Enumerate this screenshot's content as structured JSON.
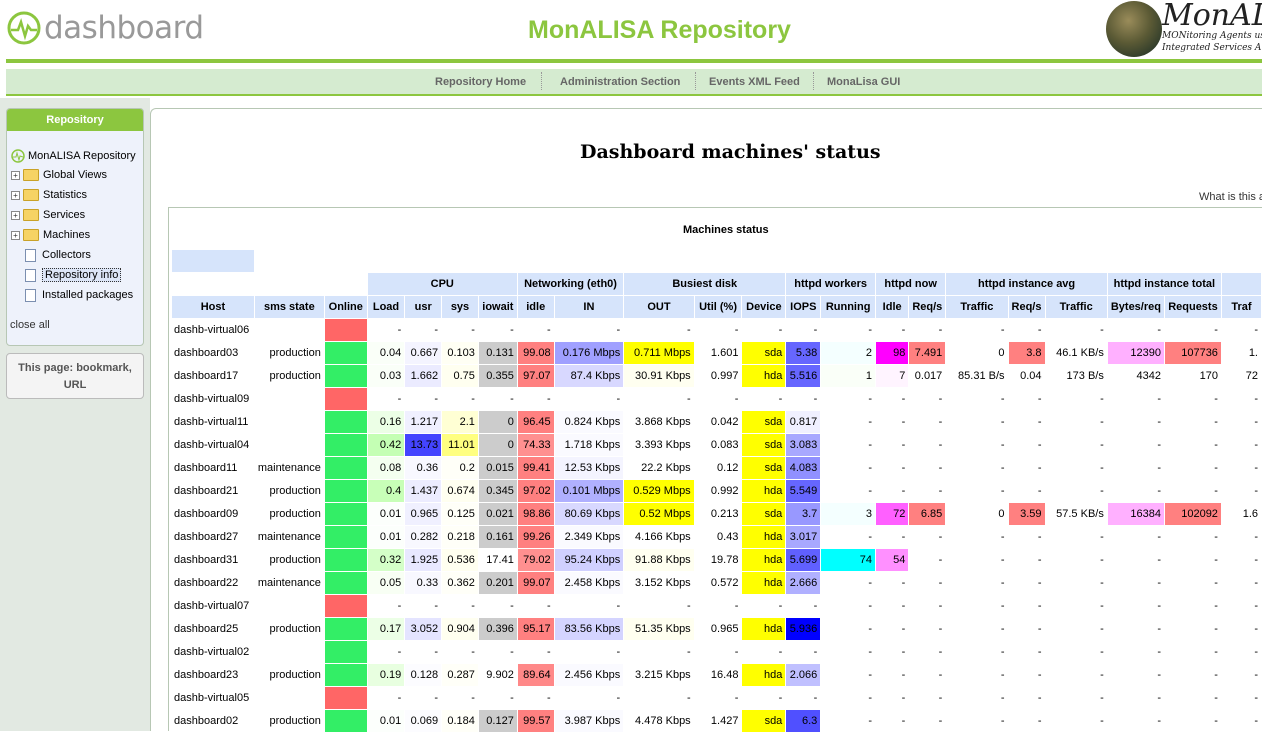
{
  "header": {
    "logo_text": "dashboard",
    "site_title": "MonALISA Repository",
    "monalisa_name": "MonALI",
    "monalisa_sub1": "MONitoring Agents usi",
    "monalisa_sub2": "Integrated Services Archi"
  },
  "nav": {
    "items": [
      "Repository Home",
      "Administration Section",
      "Events XML Feed",
      "MonaLisa GUI"
    ]
  },
  "sidebar": {
    "box_title": "Repository",
    "tree": [
      {
        "label": "MonALISA Repository",
        "type": "root"
      },
      {
        "label": "Global Views",
        "type": "folder"
      },
      {
        "label": "Statistics",
        "type": "folder"
      },
      {
        "label": "Services",
        "type": "folder"
      },
      {
        "label": "Machines",
        "type": "folder"
      },
      {
        "label": "Collectors",
        "type": "doc"
      },
      {
        "label": "Repository info",
        "type": "doc",
        "selected": true
      },
      {
        "label": "Installed packages",
        "type": "doc"
      }
    ],
    "close_all": "close all",
    "page_box_line1": "This page: bookmark,",
    "page_box_line2": "URL"
  },
  "main": {
    "page_title": "Dashboard machines' status",
    "what_is_this": "What is this a",
    "table_title": "Machines status"
  },
  "colors": {
    "accent_green": "#8cc63f",
    "online_green": "#33ee66",
    "offline_red": "#ff6666",
    "header_blue": "#d6e4fb"
  },
  "table": {
    "group_headers": [
      {
        "label": "",
        "span": 3
      },
      {
        "label": "CPU",
        "span": 4
      },
      {
        "label": "Networking (eth0)",
        "span": 2
      },
      {
        "label": "Busiest disk",
        "span": 3
      },
      {
        "label": "httpd workers",
        "span": 2
      },
      {
        "label": "httpd now",
        "span": 2
      },
      {
        "label": "httpd instance avg",
        "span": 3
      },
      {
        "label": "httpd instance total",
        "span": 2
      },
      {
        "label": "",
        "span": 1
      }
    ],
    "columns": [
      "Host",
      "sms state",
      "Online",
      "Load",
      "usr",
      "sys",
      "iowait",
      "idle",
      "IN",
      "OUT",
      "Util (%)",
      "Device",
      "IOPS",
      "Running",
      "Idle",
      "Req/s",
      "Traffic",
      "Req/s",
      "Traffic",
      "Bytes/req",
      "Requests",
      "Traf"
    ],
    "rows": [
      {
        "host": "dashb-virtual06",
        "sms": "",
        "online": false,
        "cells": [
          "-",
          "-",
          "-",
          "-",
          "-",
          "-",
          "-",
          "-",
          "-",
          "-",
          "-",
          "-",
          "-",
          "-",
          "-",
          "-",
          "-",
          "-",
          "-"
        ],
        "colors": [
          "",
          "",
          "",
          "",
          "",
          "",
          "",
          "",
          "",
          "",
          "",
          "",
          "",
          "",
          "",
          "",
          "",
          "",
          ""
        ]
      },
      {
        "host": "dashboard03",
        "sms": "production",
        "online": true,
        "cells": [
          "0.04",
          "0.667",
          "0.103",
          "0.131",
          "99.08",
          "0.176 Mbps",
          "0.711 Mbps",
          "1.601",
          "sda",
          "5.38",
          "2",
          "98",
          "7.491",
          "0",
          "3.8",
          "46.1 KB/s",
          "12390",
          "107736",
          "1."
        ],
        "colors": [
          "#fafff8",
          "#f4f4ff",
          "#fffff4",
          "#cccccc",
          "#ff8080",
          "#a0a0ff",
          "#ffff00",
          "",
          "#ffff00",
          "#6666ff",
          "#f4ffff",
          "#ff00ff",
          "#ff8080",
          "",
          "#ff8080",
          "",
          "#ffb0ff",
          "#ff8080",
          ""
        ]
      },
      {
        "host": "dashboard17",
        "sms": "production",
        "online": true,
        "cells": [
          "0.03",
          "1.662",
          "0.75",
          "0.355",
          "97.07",
          "87.4 Kbps",
          "30.91 Kbps",
          "0.997",
          "hda",
          "5.516",
          "1",
          "7",
          "0.017",
          "85.31 B/s",
          "0.04",
          "173 B/s",
          "4342",
          "170",
          "72"
        ],
        "colors": [
          "#fafff8",
          "#ebebff",
          "#fffff0",
          "#cccccc",
          "#ff8080",
          "#d8d8ff",
          "#fffff0",
          "",
          "#ffff00",
          "#6666ff",
          "#fafff8",
          "#fff4ff",
          "",
          "",
          "",
          "",
          "",
          "",
          ""
        ]
      },
      {
        "host": "dashb-virtual09",
        "sms": "",
        "online": false,
        "cells": [
          "-",
          "-",
          "-",
          "-",
          "-",
          "-",
          "-",
          "-",
          "-",
          "-",
          "-",
          "-",
          "-",
          "-",
          "-",
          "-",
          "-",
          "-",
          "-"
        ],
        "colors": [
          "",
          "",
          "",
          "",
          "",
          "",
          "",
          "",
          "",
          "",
          "",
          "",
          "",
          "",
          "",
          "",
          "",
          "",
          ""
        ]
      },
      {
        "host": "dashb-virtual11",
        "sms": "",
        "online": true,
        "cells": [
          "0.16",
          "1.217",
          "2.1",
          "0",
          "96.45",
          "0.824 Kbps",
          "3.868 Kbps",
          "0.042",
          "sda",
          "0.817",
          "-",
          "-",
          "-",
          "-",
          "-",
          "-",
          "-",
          "-",
          "-"
        ],
        "colors": [
          "#ecffe6",
          "#f0f0ff",
          "#ffffd4",
          "#cccccc",
          "#ff8080",
          "#fafaff",
          "",
          "",
          "#ffff00",
          "#f0f0ff",
          "",
          "",
          "",
          "",
          "",
          "",
          "",
          "",
          ""
        ]
      },
      {
        "host": "dashb-virtual04",
        "sms": "",
        "online": true,
        "cells": [
          "0.42",
          "13.73",
          "11.01",
          "0",
          "74.33",
          "1.718 Kbps",
          "3.393 Kbps",
          "0.083",
          "sda",
          "3.083",
          "-",
          "-",
          "-",
          "-",
          "-",
          "-",
          "-",
          "-",
          "-"
        ],
        "colors": [
          "#c4ffb4",
          "#4444ff",
          "#ffff80",
          "#cccccc",
          "#ff9090",
          "#fafaff",
          "",
          "",
          "#ffff00",
          "#a8a8ff",
          "",
          "",
          "",
          "",
          "",
          "",
          "",
          "",
          ""
        ]
      },
      {
        "host": "dashboard11",
        "sms": "maintenance",
        "online": true,
        "cells": [
          "0.08",
          "0.36",
          "0.2",
          "0.015",
          "99.41",
          "12.53 Kbps",
          "22.2 Kbps",
          "0.12",
          "sda",
          "4.083",
          "-",
          "-",
          "-",
          "-",
          "-",
          "-",
          "-",
          "-",
          "-"
        ],
        "colors": [
          "#f4fff0",
          "#f8f8ff",
          "#fffff8",
          "#cccccc",
          "#ff8080",
          "#f4f4ff",
          "",
          "",
          "#ffff00",
          "#9090ff",
          "",
          "",
          "",
          "",
          "",
          "",
          "",
          "",
          ""
        ]
      },
      {
        "host": "dashboard21",
        "sms": "production",
        "online": true,
        "cells": [
          "0.4",
          "1.437",
          "0.674",
          "0.345",
          "97.02",
          "0.101 Mbps",
          "0.529 Mbps",
          "0.992",
          "hda",
          "5.549",
          "-",
          "-",
          "-",
          "-",
          "-",
          "-",
          "-",
          "-",
          "-"
        ],
        "colors": [
          "#c8ffb8",
          "#ececff",
          "#fffff0",
          "#cccccc",
          "#ff8080",
          "#b0b0ff",
          "#ffff00",
          "",
          "#ffff00",
          "#6666ff",
          "",
          "",
          "",
          "",
          "",
          "",
          "",
          "",
          ""
        ]
      },
      {
        "host": "dashboard09",
        "sms": "production",
        "online": true,
        "cells": [
          "0.01",
          "0.965",
          "0.125",
          "0.021",
          "98.86",
          "80.69 Kbps",
          "0.52 Mbps",
          "0.213",
          "sda",
          "3.7",
          "3",
          "72",
          "6.85",
          "0",
          "3.59",
          "57.5 KB/s",
          "16384",
          "102092",
          "1.6"
        ],
        "colors": [
          "#fcfffc",
          "#f0f0ff",
          "#fffff8",
          "#cccccc",
          "#ff8080",
          "#d8d8ff",
          "#ffff00",
          "",
          "#ffff00",
          "#9898ff",
          "#f4ffff",
          "#ff60ff",
          "#ff8080",
          "",
          "#ff8080",
          "",
          "#ffb0ff",
          "#ff8080",
          ""
        ]
      },
      {
        "host": "dashboard27",
        "sms": "maintenance",
        "online": true,
        "cells": [
          "0.01",
          "0.282",
          "0.218",
          "0.161",
          "99.26",
          "2.349 Kbps",
          "4.166 Kbps",
          "0.43",
          "hda",
          "3.017",
          "-",
          "-",
          "-",
          "-",
          "-",
          "-",
          "-",
          "-",
          "-"
        ],
        "colors": [
          "#fcfffc",
          "#f8f8ff",
          "#fffff8",
          "#cccccc",
          "#ff8080",
          "#fafaff",
          "",
          "",
          "#ffff00",
          "#a8a8ff",
          "",
          "",
          "",
          "",
          "",
          "",
          "",
          "",
          ""
        ]
      },
      {
        "host": "dashboard31",
        "sms": "production",
        "online": true,
        "cells": [
          "0.32",
          "1.925",
          "0.536",
          "17.41",
          "79.02",
          "95.24 Kbps",
          "91.88 Kbps",
          "19.78",
          "hda",
          "5.699",
          "74",
          "54",
          "-",
          "-",
          "-",
          "-",
          "-",
          "-",
          "-"
        ],
        "colors": [
          "#d4ffc8",
          "#e8e8ff",
          "#fffff0",
          "",
          "#ff9090",
          "#d0d0ff",
          "#fffff0",
          "",
          "#ffff00",
          "#6060ff",
          "#00ffff",
          "#ff90ff",
          "",
          "",
          "",
          "",
          "",
          "",
          ""
        ]
      },
      {
        "host": "dashboard22",
        "sms": "maintenance",
        "online": true,
        "cells": [
          "0.05",
          "0.33",
          "0.362",
          "0.201",
          "99.07",
          "2.458 Kbps",
          "3.152 Kbps",
          "0.572",
          "hda",
          "2.666",
          "-",
          "-",
          "-",
          "-",
          "-",
          "-",
          "-",
          "-",
          "-"
        ],
        "colors": [
          "#f8fff4",
          "#f8f8ff",
          "#fffff8",
          "#cccccc",
          "#ff8080",
          "#fafaff",
          "",
          "",
          "#ffff00",
          "#b0b0ff",
          "",
          "",
          "",
          "",
          "",
          "",
          "",
          "",
          ""
        ]
      },
      {
        "host": "dashb-virtual07",
        "sms": "",
        "online": false,
        "cells": [
          "-",
          "-",
          "-",
          "-",
          "-",
          "-",
          "-",
          "-",
          "-",
          "-",
          "-",
          "-",
          "-",
          "-",
          "-",
          "-",
          "-",
          "-",
          "-"
        ],
        "colors": [
          "",
          "",
          "",
          "",
          "",
          "",
          "",
          "",
          "",
          "",
          "",
          "",
          "",
          "",
          "",
          "",
          "",
          "",
          ""
        ]
      },
      {
        "host": "dashboard25",
        "sms": "production",
        "online": true,
        "cells": [
          "0.17",
          "3.052",
          "0.904",
          "0.396",
          "95.17",
          "83.56 Kbps",
          "51.35 Kbps",
          "0.965",
          "hda",
          "5.936",
          "-",
          "-",
          "-",
          "-",
          "-",
          "-",
          "-",
          "-",
          "-"
        ],
        "colors": [
          "#ecffe6",
          "#e4e4ff",
          "#fffff0",
          "#cccccc",
          "#ff8080",
          "#d4d4ff",
          "#fffff0",
          "",
          "#ffff00",
          "#0000ff",
          "",
          "",
          "",
          "",
          "",
          "",
          "",
          "",
          ""
        ]
      },
      {
        "host": "dashb-virtual02",
        "sms": "",
        "online": true,
        "cells": [
          "-",
          "-",
          "-",
          "-",
          "-",
          "-",
          "-",
          "-",
          "-",
          "-",
          "-",
          "-",
          "-",
          "-",
          "-",
          "-",
          "-",
          "-",
          "-"
        ],
        "colors": [
          "",
          "",
          "",
          "",
          "",
          "",
          "",
          "",
          "",
          "",
          "",
          "",
          "",
          "",
          "",
          "",
          "",
          "",
          ""
        ]
      },
      {
        "host": "dashboard23",
        "sms": "production",
        "online": true,
        "cells": [
          "0.19",
          "0.128",
          "0.287",
          "9.902",
          "89.64",
          "2.456 Kbps",
          "3.215 Kbps",
          "16.48",
          "hda",
          "2.066",
          "-",
          "-",
          "-",
          "-",
          "-",
          "-",
          "-",
          "-",
          "-"
        ],
        "colors": [
          "#e8ffe0",
          "#fcfcff",
          "#fffff8",
          "",
          "#ff8888",
          "#fafaff",
          "",
          "",
          "#ffff00",
          "#c0c0ff",
          "",
          "",
          "",
          "",
          "",
          "",
          "",
          "",
          ""
        ]
      },
      {
        "host": "dashb-virtual05",
        "sms": "",
        "online": false,
        "cells": [
          "-",
          "-",
          "-",
          "-",
          "-",
          "-",
          "-",
          "-",
          "-",
          "-",
          "-",
          "-",
          "-",
          "-",
          "-",
          "-",
          "-",
          "-",
          "-"
        ],
        "colors": [
          "",
          "",
          "",
          "",
          "",
          "",
          "",
          "",
          "",
          "",
          "",
          "",
          "",
          "",
          "",
          "",
          "",
          "",
          ""
        ]
      },
      {
        "host": "dashboard02",
        "sms": "production",
        "online": true,
        "cells": [
          "0.01",
          "0.069",
          "0.184",
          "0.127",
          "99.57",
          "3.987 Kbps",
          "4.478 Kbps",
          "1.427",
          "sda",
          "6.3",
          "-",
          "-",
          "-",
          "-",
          "-",
          "-",
          "-",
          "-",
          "-"
        ],
        "colors": [
          "#fcfffc",
          "#fcfcff",
          "#fffff8",
          "#cccccc",
          "#ff8080",
          "#fafaff",
          "",
          "",
          "#ffff00",
          "#5050ff",
          "",
          "",
          "",
          "",
          "",
          "",
          "",
          "",
          ""
        ]
      }
    ]
  }
}
